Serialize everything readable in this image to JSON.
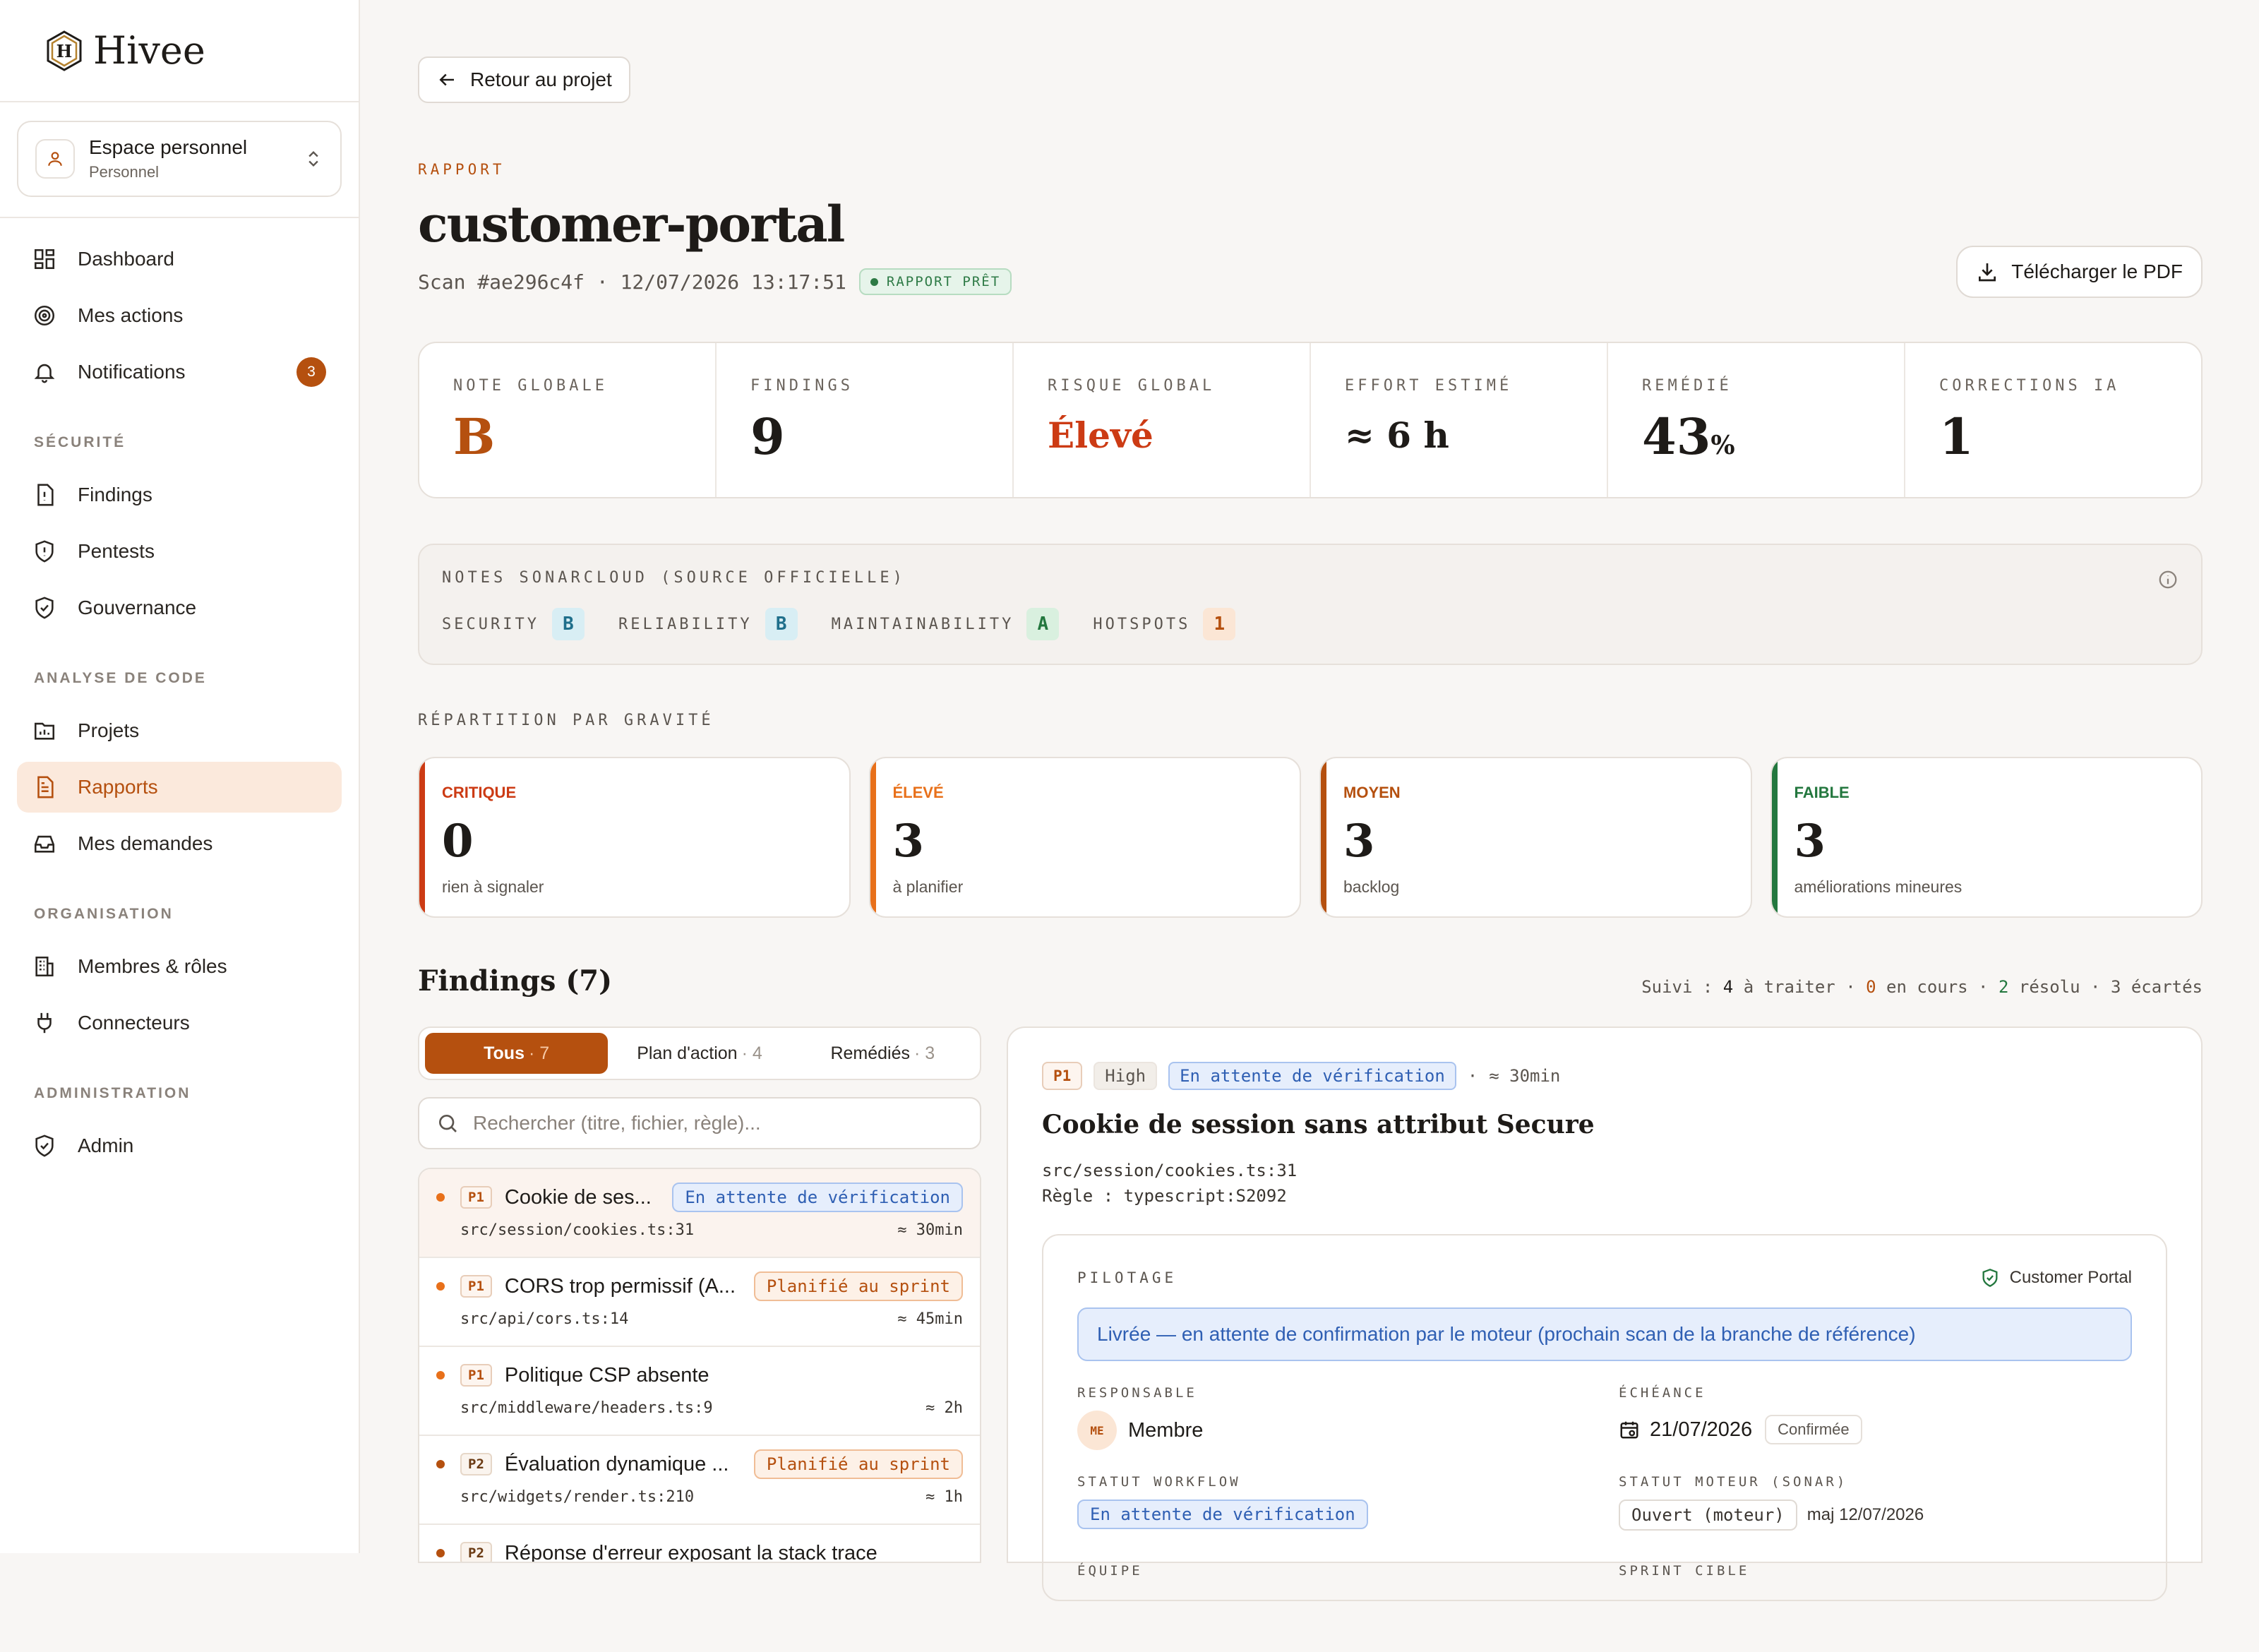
{
  "app": {
    "name": "Hivee"
  },
  "workspace": {
    "name": "Espace personnel",
    "sub": "Personnel"
  },
  "nav": {
    "dashboard": "Dashboard",
    "actions": "Mes actions",
    "notifications": "Notifications",
    "notifications_count": "3",
    "section_security": "SÉCURITÉ",
    "findings": "Findings",
    "pentests": "Pentests",
    "gouvernance": "Gouvernance",
    "section_code": "ANALYSE DE CODE",
    "projets": "Projets",
    "rapports": "Rapports",
    "demandes": "Mes demandes",
    "section_org": "ORGANISATION",
    "membres": "Membres & rôles",
    "connecteurs": "Connecteurs",
    "section_admin": "ADMINISTRATION",
    "admin": "Admin"
  },
  "header": {
    "back": "Retour au projet",
    "eyebrow": "RAPPORT",
    "title": "customer-portal",
    "scan": "Scan #ae296c4f · 12/07/2026 13:17:51",
    "status": "RAPPORT PRÊT",
    "pdf": "Télécharger le PDF"
  },
  "stats": {
    "note_label": "NOTE GLOBALE",
    "note_value": "B",
    "findings_label": "FINDINGS",
    "findings_value": "9",
    "risk_label": "RISQUE GLOBAL",
    "risk_value": "Élevé",
    "effort_label": "EFFORT ESTIMÉ",
    "effort_value": "≈ 6 h",
    "remedie_label": "REMÉDIÉ",
    "remedie_value": "43",
    "remedie_unit": "%",
    "ia_label": "CORRECTIONS IA",
    "ia_value": "1"
  },
  "sonar": {
    "label": "NOTES SONARCLOUD (SOURCE OFFICIELLE)",
    "security_label": "SECURITY",
    "security": "B",
    "reliability_label": "RELIABILITY",
    "reliability": "B",
    "maintainability_label": "MAINTAINABILITY",
    "maintainability": "A",
    "hotspots_label": "HOTSPOTS",
    "hotspots": "1"
  },
  "severity": {
    "label": "RÉPARTITION PAR GRAVITÉ",
    "items": [
      {
        "name": "CRITIQUE",
        "count": "0",
        "sub": "rien à signaler",
        "color": "#cc3b14"
      },
      {
        "name": "ÉLEVÉ",
        "count": "3",
        "sub": "à planifier",
        "color": "#e8701a"
      },
      {
        "name": "MOYEN",
        "count": "3",
        "sub": "backlog",
        "color": "#b5500f"
      },
      {
        "name": "FAIBLE",
        "count": "3",
        "sub": "améliorations mineures",
        "color": "#23773e"
      }
    ]
  },
  "findings": {
    "title": "Findings (7)",
    "suivi_label": "Suivi :",
    "a_traiter": "4",
    "a_traiter_label": "à traiter",
    "en_cours": "0",
    "en_cours_label": "en cours",
    "resolu": "2",
    "resolu_label": "résolu",
    "ecartes": "3",
    "ecartes_label": "écartés",
    "tabs": [
      {
        "label": "Tous",
        "count": "· 7"
      },
      {
        "label": "Plan d'action",
        "count": "· 4"
      },
      {
        "label": "Remédiés",
        "count": "· 3"
      }
    ],
    "search_placeholder": "Rechercher (titre, fichier, règle)...",
    "items": [
      {
        "priority": "P1",
        "title": "Cookie de ses...",
        "status": "En attente de vérification",
        "path": "src/session/cookies.ts:31",
        "effort": "≈ 30min"
      },
      {
        "priority": "P1",
        "title": "CORS trop permissif (A...",
        "status": "Planifié au sprint",
        "path": "src/api/cors.ts:14",
        "effort": "≈ 45min"
      },
      {
        "priority": "P1",
        "title": "Politique CSP absente",
        "status": "",
        "path": "src/middleware/headers.ts:9",
        "effort": "≈ 2h"
      },
      {
        "priority": "P2",
        "title": "Évaluation dynamique ...",
        "status": "Planifié au sprint",
        "path": "src/widgets/render.ts:210",
        "effort": "≈ 1h"
      },
      {
        "priority": "P2",
        "title": "Réponse d'erreur exposant la stack trace",
        "status": "",
        "path": "",
        "effort": ""
      }
    ]
  },
  "detail": {
    "priority": "P1",
    "severity": "High",
    "status": "En attente de vérification",
    "effort": "≈ 30min",
    "title": "Cookie de session sans attribut Secure",
    "path": "src/session/cookies.ts:31",
    "rule": "Règle : typescript:S2092",
    "pilotage_label": "PILOTAGE",
    "project": "Customer Portal",
    "notice": "Livrée — en attente de confirmation par le moteur (prochain scan de la branche de référence)",
    "responsable_label": "RESPONSABLE",
    "responsable_initials": "ME",
    "responsable": "Membre",
    "echeance_label": "ÉCHÉANCE",
    "echeance": "21/07/2026",
    "echeance_status": "Confirmée",
    "workflow_label": "STATUT WORKFLOW",
    "workflow": "En attente de vérification",
    "moteur_label": "STATUT MOTEUR (SONAR)",
    "moteur": "Ouvert (moteur)",
    "moteur_date": "maj 12/07/2026",
    "equipe_label": "ÉQUIPE",
    "sprint_label": "SPRINT CIBLE"
  }
}
